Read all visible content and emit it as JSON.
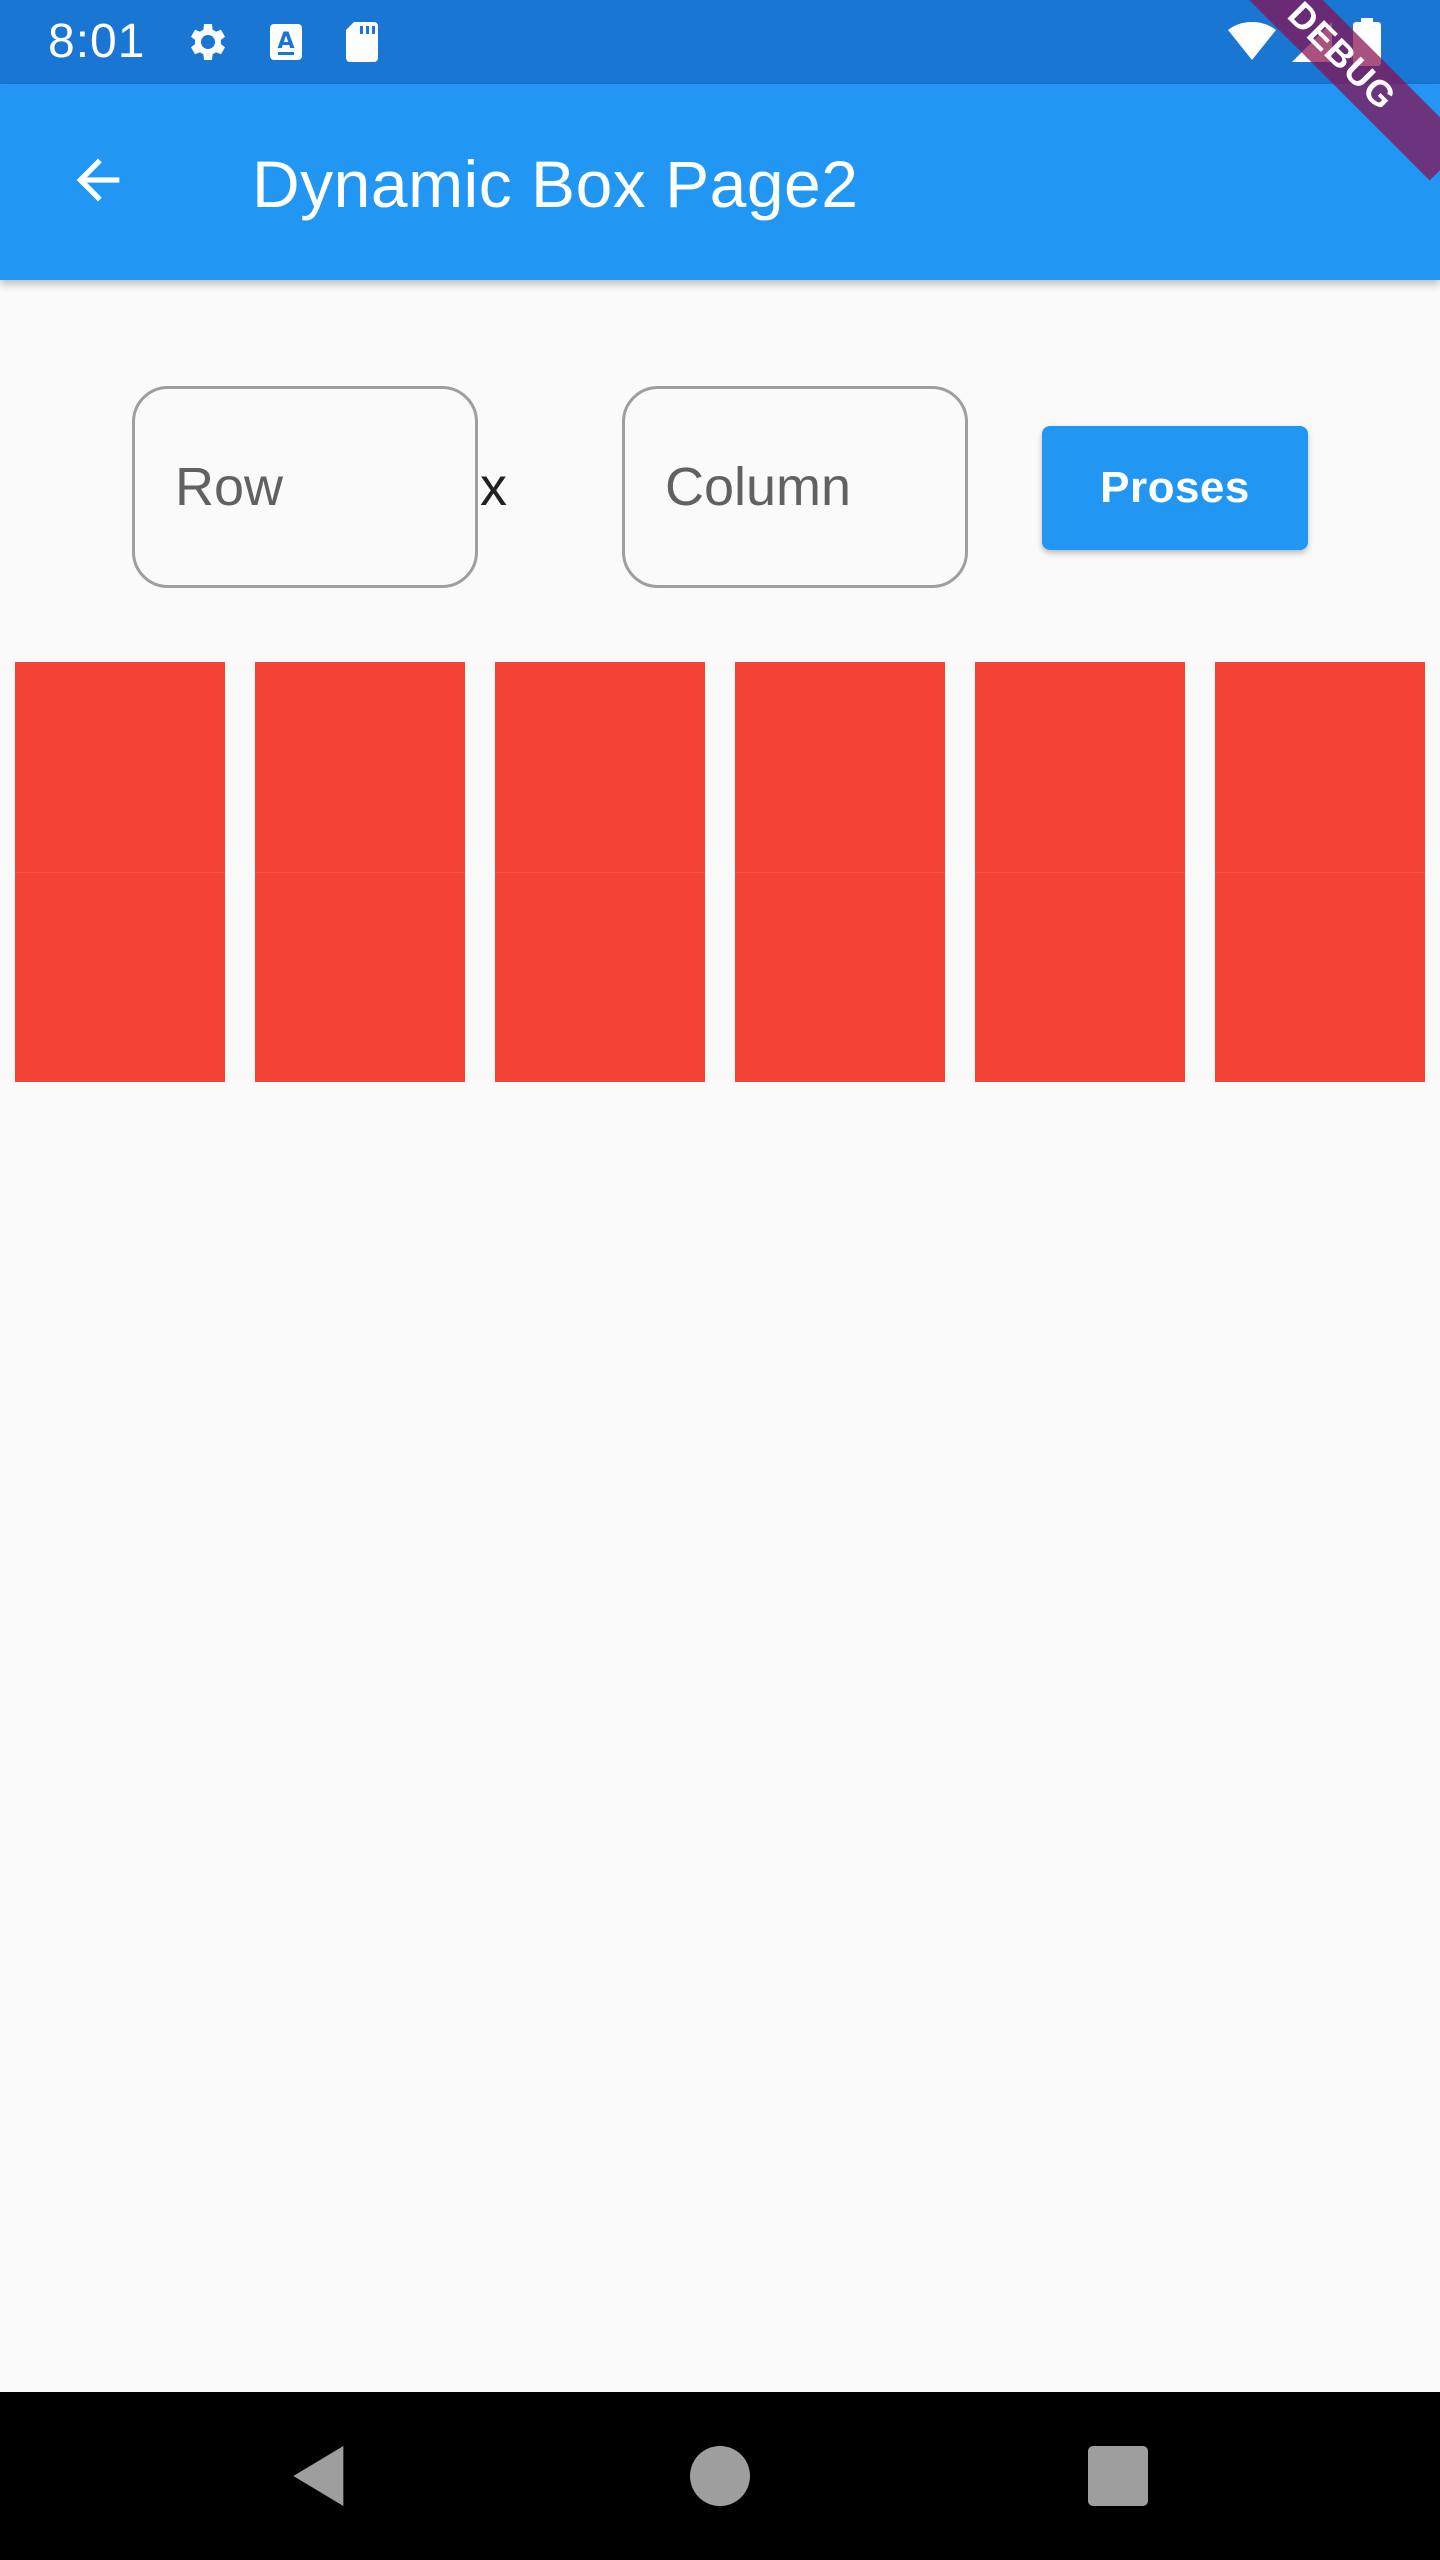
{
  "status_bar": {
    "time": "8:01",
    "icons": [
      "gear-icon",
      "a-letter-icon",
      "sd-card-icon",
      "wifi-icon",
      "signal-icon",
      "battery-icon"
    ],
    "background_color": "#1976d2"
  },
  "app_bar": {
    "title": "Dynamic Box Page2",
    "back_icon": "arrow-back-icon",
    "background_color": "#2196f3"
  },
  "debug_banner": {
    "label": "DEBUG"
  },
  "form": {
    "row_placeholder": "Row",
    "row_value": "",
    "separator": "x",
    "column_placeholder": "Column",
    "column_value": "",
    "submit_label": "Proses"
  },
  "grid": {
    "rows": 2,
    "columns": 6,
    "box_color": "#f44336"
  },
  "nav_bar": {
    "icons": [
      "back-triangle-icon",
      "home-circle-icon",
      "recents-square-icon"
    ]
  }
}
